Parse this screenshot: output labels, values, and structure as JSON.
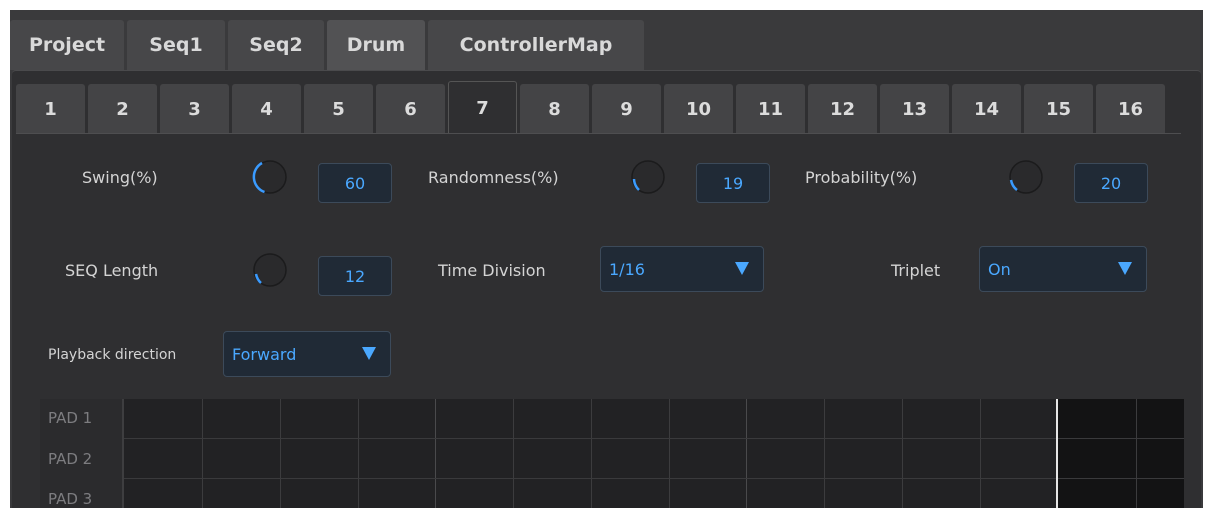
{
  "top_tabs": [
    {
      "label": "Project",
      "active": false
    },
    {
      "label": "Seq1",
      "active": false
    },
    {
      "label": "Seq2",
      "active": false
    },
    {
      "label": "Drum",
      "active": true
    },
    {
      "label": "ControllerMap",
      "active": false
    }
  ],
  "num_tabs": [
    "1",
    "2",
    "3",
    "4",
    "5",
    "6",
    "7",
    "8",
    "9",
    "10",
    "11",
    "12",
    "13",
    "14",
    "15",
    "16"
  ],
  "active_num_tab": "7",
  "params": {
    "swing": {
      "label": "Swing(%)",
      "value": "60"
    },
    "randomness": {
      "label": "Randomness(%)",
      "value": "19"
    },
    "probability": {
      "label": "Probability(%)",
      "value": "20"
    },
    "seq_length": {
      "label": "SEQ Length",
      "value": "12"
    },
    "time_division": {
      "label": "Time Division",
      "value": "1/16"
    },
    "triplet": {
      "label": "Triplet",
      "value": "On"
    },
    "playback_direction": {
      "label": "Playback direction",
      "value": "Forward"
    }
  },
  "pads": [
    "PAD  1",
    "PAD  2",
    "PAD  3"
  ],
  "colors": {
    "accent": "#4aa8ff",
    "background": "#3a3a3c",
    "panel": "#2f2f31"
  }
}
